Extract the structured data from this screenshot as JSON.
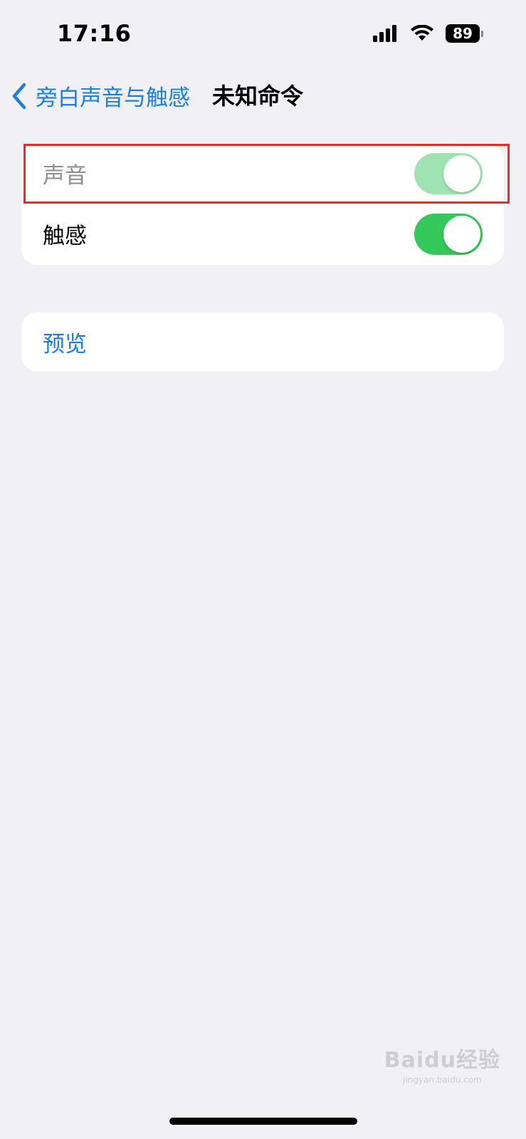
{
  "status_bar": {
    "time": "17:16",
    "battery": "89"
  },
  "nav": {
    "back_label": "旁白声音与触感",
    "title": "未知命令",
    "accent_color": "#1a7fe0"
  },
  "group_1": {
    "rows": [
      {
        "label": "声音",
        "toggle_on": true,
        "dimmed": true
      },
      {
        "label": "触感",
        "toggle_on": true,
        "dimmed": false
      }
    ]
  },
  "group_2": {
    "preview_label": "预览"
  },
  "watermark": {
    "main": "Baidu经验",
    "sub": "jingyan.baidu.com"
  },
  "colors": {
    "background": "#f0f0f5",
    "toggle_on": "#34c759",
    "toggle_dimmed": "#9fe3b2",
    "highlight": "#e0302a"
  }
}
